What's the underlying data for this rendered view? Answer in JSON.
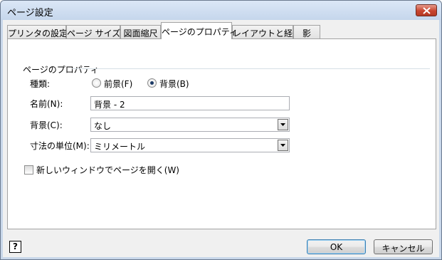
{
  "window": {
    "title": "ページ設定"
  },
  "tabs": [
    {
      "label": "プリンタの設定"
    },
    {
      "label": "ページ サイズ"
    },
    {
      "label": "図面縮尺"
    },
    {
      "label": "ページのプロパティ"
    },
    {
      "label": "レイアウトと経路"
    },
    {
      "label": "影"
    }
  ],
  "active_tab": "ページのプロパティ",
  "group": {
    "label": "ページのプロパティ"
  },
  "type_row": {
    "label": "種類:",
    "options": [
      {
        "label": "前景(F)"
      },
      {
        "label": "背景(B)"
      }
    ],
    "selected": "背景(B)"
  },
  "name_row": {
    "label": "名前(N):",
    "value": "背景 - 2"
  },
  "background_row": {
    "label": "背景(C):",
    "value": "なし"
  },
  "unit_row": {
    "label": "寸法の単位(M):",
    "value": "ミリメートル"
  },
  "new_window_checkbox": {
    "label": "新しいウィンドウでページを開く(W)",
    "checked": false
  },
  "buttons": {
    "ok": "OK",
    "cancel": "キャンセル"
  },
  "icons": {
    "help": "help-icon",
    "close": "close-icon",
    "dropdown": "chevron-down-icon"
  },
  "colors": {
    "title_bar": "#c8d7ea",
    "close_button": "#c8452f",
    "dialog_bg": "#f0f0f0",
    "panel_bg": "#ffffff"
  }
}
